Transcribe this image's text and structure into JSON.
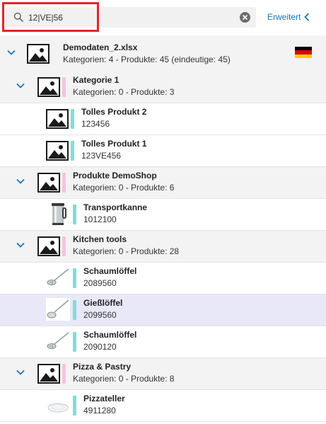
{
  "search": {
    "value": "12|VE|56",
    "placeholder": ""
  },
  "advanced_label": "Erweitert",
  "tree": {
    "root": {
      "title": "Demodaten_2.xlsx",
      "subtitle": "Kategorien: 4 - Produkte: 45 (eindeutige: 45)"
    },
    "cat1": {
      "title": "Kategorie 1",
      "subtitle": "Kategorien: 0 - Produkte: 3"
    },
    "cat1_p1": {
      "title": "Tolles Produkt 2",
      "code": "123456"
    },
    "cat1_p2": {
      "title": "Tolles Produkt 1",
      "code": "123VE456"
    },
    "cat2": {
      "title": "Produkte DemoShop",
      "subtitle": "Kategorien: 0 - Produkte: 6"
    },
    "cat2_p1": {
      "title": "Transportkanne",
      "code": "1012100"
    },
    "cat3": {
      "title": "Kitchen tools",
      "subtitle": "Kategorien: 0 - Produkte: 28"
    },
    "cat3_p1": {
      "title": "Schaumlöffel",
      "code": "2089560"
    },
    "cat3_p2": {
      "title": "Gießlöffel",
      "code": "2099560"
    },
    "cat3_p3": {
      "title": "Schaumlöffel",
      "code": "2090120"
    },
    "cat4": {
      "title": "Pizza & Pastry",
      "subtitle": "Kategorien: 0 - Produkte: 8"
    },
    "cat4_p1": {
      "title": "Pizzateller",
      "code": "4911280"
    }
  },
  "colors": {
    "accent": "#1a73b8",
    "highlight": "#e3252a",
    "category_stripe": "#f6c3dc",
    "product_stripe": "#7fdfd4",
    "selected_row": "#e8e8f8"
  },
  "icons": {
    "search": "search-icon",
    "clear": "clear-icon",
    "collapse": "chevron-down-icon",
    "back": "chevron-left-icon",
    "placeholder_image": "image-placeholder-icon",
    "language_flag": "german-flag-icon"
  }
}
